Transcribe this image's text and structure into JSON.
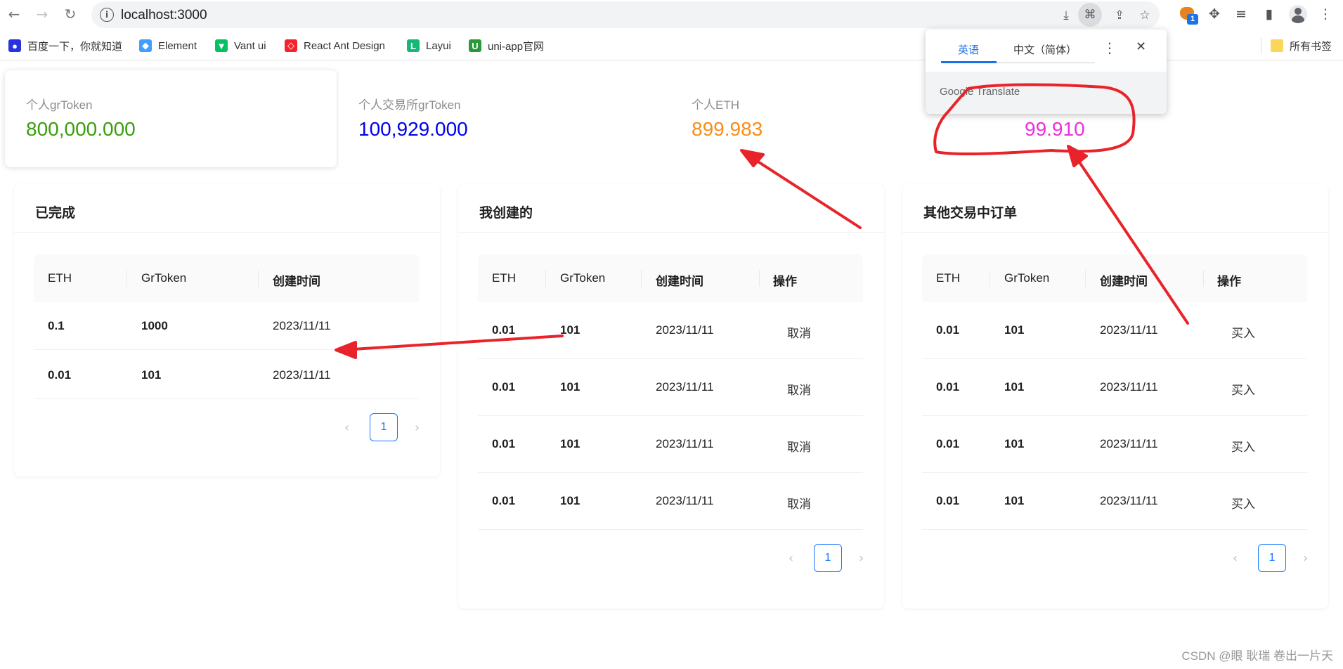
{
  "browser": {
    "url": "localhost:3000",
    "bookmarks": [
      {
        "label": "百度一下，你就知道",
        "icon": "baidu-icon",
        "color": "#2932e1"
      },
      {
        "label": "Element",
        "icon": "element-icon",
        "color": "#409eff"
      },
      {
        "label": "Vant ui",
        "icon": "vant-icon",
        "color": "#07c160"
      },
      {
        "label": "React Ant Design",
        "icon": "ant-design-icon",
        "color": "#f5222d"
      },
      {
        "label": "Layui",
        "icon": "layui-icon",
        "color": "#16b777"
      },
      {
        "label": "uni-app官网",
        "icon": "uniapp-icon",
        "color": "#2b9939"
      }
    ],
    "all_bookmarks": "所有书签"
  },
  "translate_popup": {
    "tab_english": "英语",
    "tab_chinese": "中文（简体）",
    "footer": "Google Translate"
  },
  "stats": [
    {
      "label": "个人grToken",
      "value": "800,000.000",
      "color": "#389e0d"
    },
    {
      "label": "个人交易所grToken",
      "value": "100,929.000",
      "color": "#0000ee"
    },
    {
      "label": "个人ETH",
      "value": "899.983",
      "color": "#fa8c16"
    },
    {
      "label": "",
      "value": "99.910",
      "color": "#eb2fdc"
    }
  ],
  "panels": {
    "completed": {
      "title": "已完成",
      "columns": [
        "ETH",
        "GrToken",
        "创建时间"
      ],
      "rows": [
        {
          "eth": "0.1",
          "gr": "1000",
          "time": "2023/11/11"
        },
        {
          "eth": "0.01",
          "gr": "101",
          "time": "2023/11/11"
        }
      ],
      "page": "1"
    },
    "created": {
      "title": "我创建的",
      "columns": [
        "ETH",
        "GrToken",
        "创建时间",
        "操作"
      ],
      "rows": [
        {
          "eth": "0.01",
          "gr": "101",
          "time": "2023/11/11",
          "op": "取消"
        },
        {
          "eth": "0.01",
          "gr": "101",
          "time": "2023/11/11",
          "op": "取消"
        },
        {
          "eth": "0.01",
          "gr": "101",
          "time": "2023/11/11",
          "op": "取消"
        },
        {
          "eth": "0.01",
          "gr": "101",
          "time": "2023/11/11",
          "op": "取消"
        }
      ],
      "page": "1"
    },
    "others": {
      "title": "其他交易中订单",
      "columns": [
        "ETH",
        "GrToken",
        "创建时间",
        "操作"
      ],
      "rows": [
        {
          "eth": "0.01",
          "gr": "101",
          "time": "2023/11/11",
          "op": "买入"
        },
        {
          "eth": "0.01",
          "gr": "101",
          "time": "2023/11/11",
          "op": "买入"
        },
        {
          "eth": "0.01",
          "gr": "101",
          "time": "2023/11/11",
          "op": "买入"
        },
        {
          "eth": "0.01",
          "gr": "101",
          "time": "2023/11/11",
          "op": "买入"
        }
      ],
      "page": "1"
    }
  },
  "watermark": "CSDN @眼 耿瑞 卷出一片天",
  "annotation_color": "#e8232a"
}
